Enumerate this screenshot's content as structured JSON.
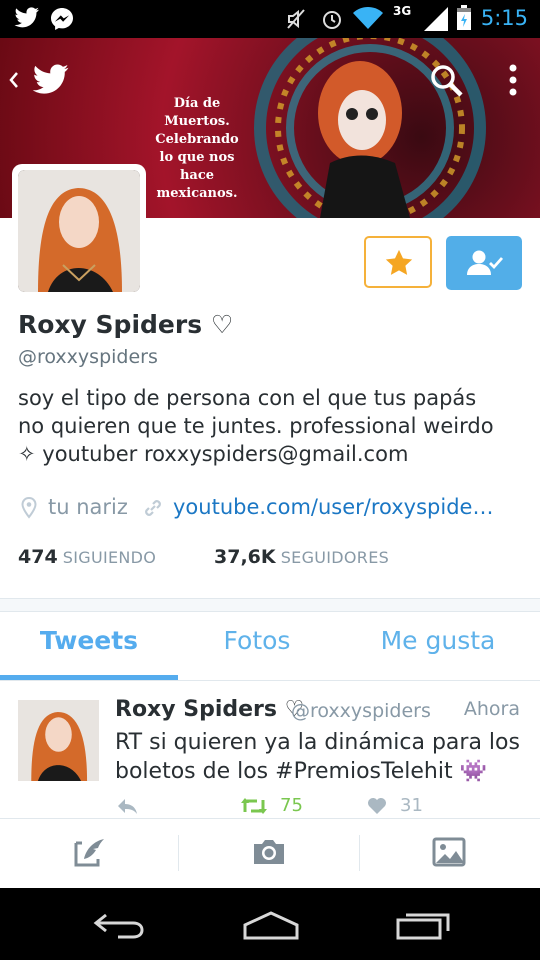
{
  "status_bar": {
    "time": "5:15",
    "network": "3G",
    "icons": [
      "twitter-icon",
      "messenger-icon",
      "mute-icon",
      "alarm-icon",
      "wifi-icon",
      "signal-icon",
      "battery-icon"
    ]
  },
  "header": {
    "banner_lines": [
      "Día de Muertos.",
      "Celebrando",
      "lo que nos hace",
      "mexicanos."
    ],
    "icons": [
      "back-icon",
      "twitter-bird-icon",
      "search-icon",
      "overflow-menu-icon"
    ]
  },
  "profile": {
    "name": "Roxy Spiders",
    "name_suffix": "♡",
    "handle": "@roxxyspiders",
    "bio_lines": [
      "soy el tipo de persona con el que tus papás",
      "no quieren que te juntes. professional weirdo",
      "✧ youtuber roxxyspiders@gmail.com"
    ],
    "location": "tu nariz",
    "website": "youtube.com/user/roxyspide…",
    "following_count": "474",
    "following_label": "SIGUIENDO",
    "followers_count": "37,6K",
    "followers_label": "SEGUIDORES"
  },
  "tabs": [
    {
      "label": "Tweets",
      "active": true
    },
    {
      "label": "Fotos",
      "active": false
    },
    {
      "label": "Me gusta",
      "active": false
    }
  ],
  "tweet": {
    "author_name": "Roxy Spiders",
    "author_suffix": "♡",
    "author_handle": "@roxxyspiders",
    "time": "Ahora",
    "text_lines": [
      "RT si quieren ya la dinámica para los",
      "boletos de los #PremiosTelehit 👾"
    ],
    "retweets": "75",
    "likes": "31"
  },
  "colors": {
    "accent": "#55acee",
    "star_border": "#f5b13a",
    "star_fill": "#f5a623",
    "retweet_green": "#7ac74f",
    "link": "#1b77c4"
  }
}
